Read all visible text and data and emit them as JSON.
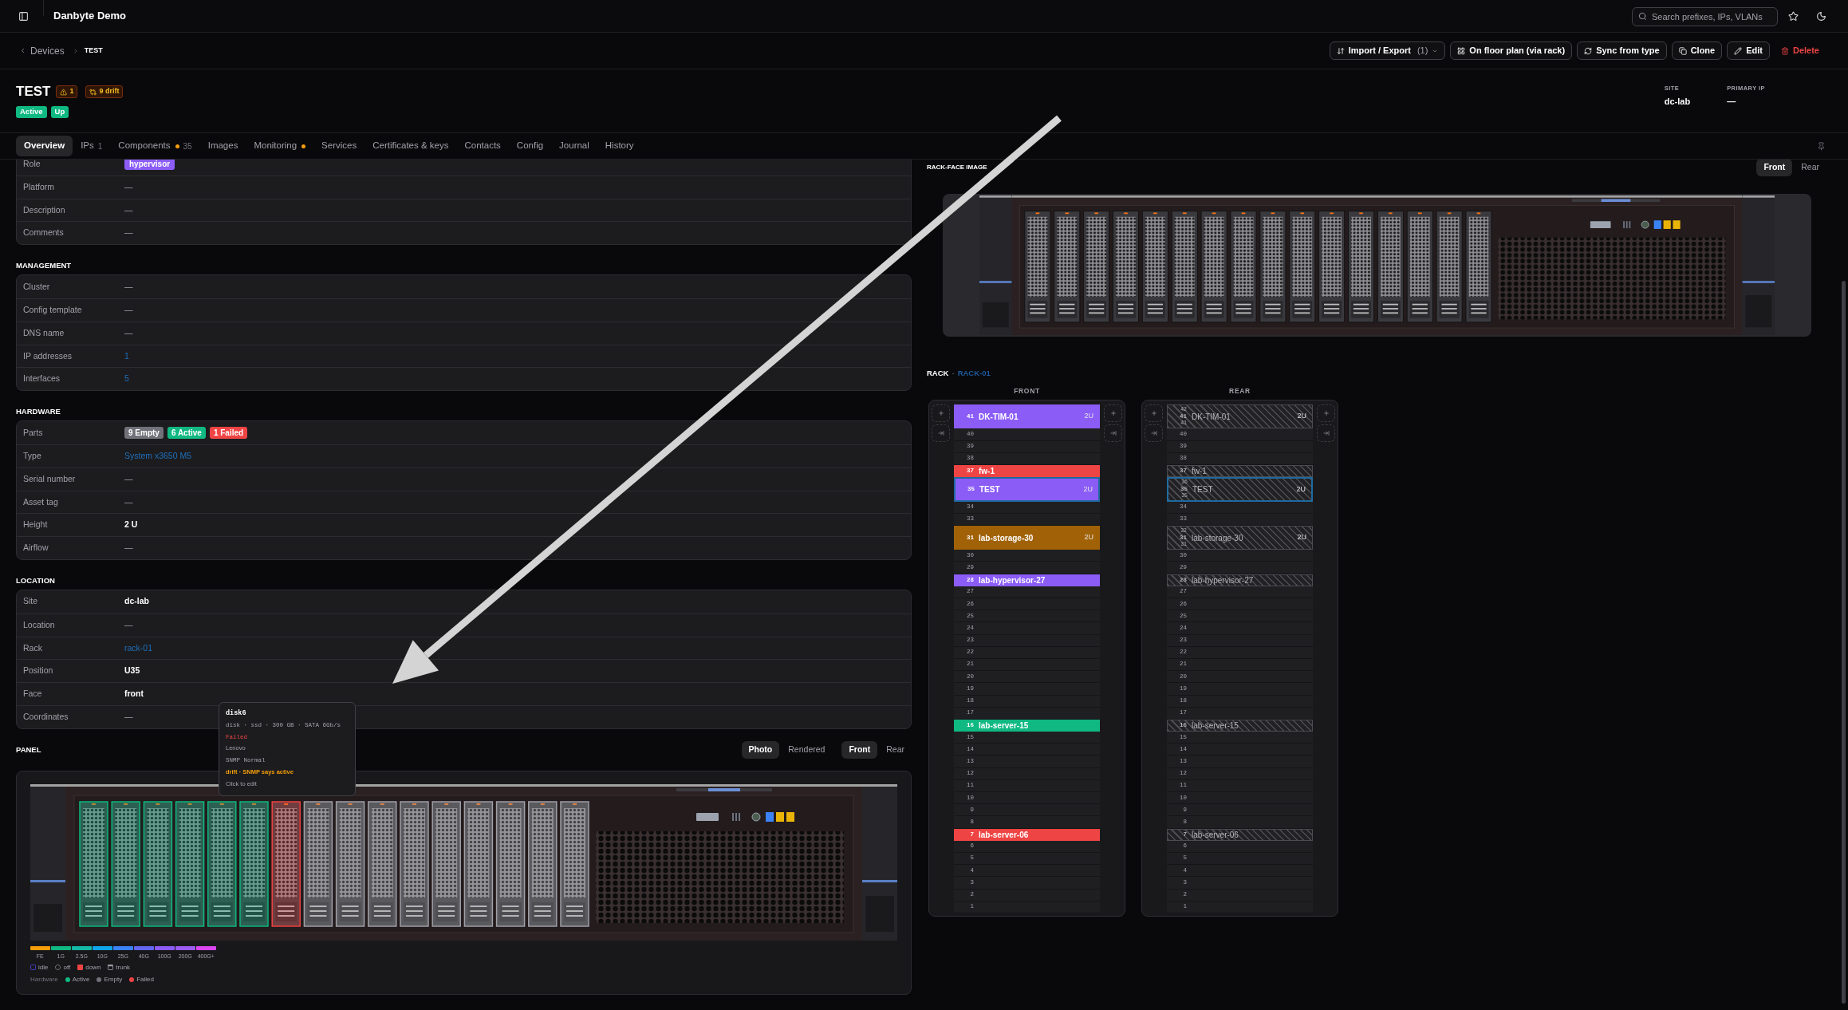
{
  "topbar": {
    "title": "Danbyte Demo",
    "search": {
      "placeholder": "Search prefixes, IPs, VLANs"
    }
  },
  "breadcrumb": {
    "parent": "Devices",
    "current": "TEST"
  },
  "actions": [
    {
      "label": "Import / Export",
      "count": "(1)",
      "kind": "menu"
    },
    {
      "label": "On floor plan (via rack)",
      "kind": "button"
    },
    {
      "label": "Sync from type",
      "kind": "button"
    },
    {
      "label": "Clone",
      "kind": "button"
    },
    {
      "label": "Edit",
      "kind": "button"
    },
    {
      "label": "Delete",
      "kind": "danger"
    }
  ],
  "device": {
    "name": "TEST",
    "warnings": "1",
    "drift": "9 drift",
    "statuses": [
      "Active",
      "Up"
    ],
    "facts": [
      {
        "label": "SITE",
        "value": "dc-lab"
      },
      {
        "label": "PRIMARY IP",
        "value": "—"
      }
    ]
  },
  "tabs": [
    {
      "label": "Overview",
      "selected": true,
      "dot": false
    },
    {
      "label": "IPs",
      "count": "1",
      "selected": false,
      "dot": false
    },
    {
      "label": "Components",
      "count": "35",
      "selected": false,
      "dot": true
    },
    {
      "label": "Images",
      "selected": false,
      "dot": false
    },
    {
      "label": "Monitoring",
      "selected": false,
      "dot": true
    },
    {
      "label": "Services",
      "selected": false,
      "dot": false
    },
    {
      "label": "Certificates & keys",
      "selected": false,
      "dot": false
    },
    {
      "label": "Contacts",
      "selected": false,
      "dot": false
    },
    {
      "label": "Config",
      "selected": false,
      "dot": false
    },
    {
      "label": "Journal",
      "selected": false,
      "dot": false
    },
    {
      "label": "History",
      "selected": false,
      "dot": false
    }
  ],
  "sections": [
    {
      "rows": [
        {
          "label": "Role",
          "kind": "badge",
          "value": "hypervisor"
        },
        {
          "label": "Platform",
          "kind": "muted",
          "value": "—"
        },
        {
          "label": "Description",
          "kind": "muted",
          "value": "—"
        },
        {
          "label": "Comments",
          "kind": "muted",
          "value": "—"
        }
      ]
    },
    {
      "title": "MANAGEMENT",
      "rows": [
        {
          "label": "Cluster",
          "kind": "muted",
          "value": "—"
        },
        {
          "label": "Config template",
          "kind": "muted",
          "value": "—"
        },
        {
          "label": "DNS name",
          "kind": "muted",
          "value": "—"
        },
        {
          "label": "IP addresses",
          "kind": "link",
          "value": "1"
        },
        {
          "label": "Interfaces",
          "kind": "link",
          "value": "5"
        }
      ]
    },
    {
      "title": "HARDWARE",
      "rows": [
        {
          "label": "Parts",
          "kind": "tags",
          "tags": [
            {
              "label": "9 Empty",
              "color": "#71717a"
            },
            {
              "label": "6 Active",
              "color": "#10b981"
            },
            {
              "label": "1 Failed",
              "color": "#ef4444"
            }
          ]
        },
        {
          "label": "Type",
          "kind": "link",
          "value": "System x3650 M5"
        },
        {
          "label": "Serial number",
          "kind": "muted",
          "value": "—"
        },
        {
          "label": "Asset tag",
          "kind": "muted",
          "value": "—"
        },
        {
          "label": "Height",
          "kind": "strong",
          "value": "2 U"
        },
        {
          "label": "Airflow",
          "kind": "muted",
          "value": "—"
        }
      ]
    },
    {
      "title": "LOCATION",
      "rows": [
        {
          "label": "Site",
          "kind": "strong",
          "value": "dc-lab"
        },
        {
          "label": "Location",
          "kind": "muted",
          "value": "—"
        },
        {
          "label": "Rack",
          "kind": "link",
          "value": "rack-01"
        },
        {
          "label": "Position",
          "kind": "strong",
          "value": "U35"
        },
        {
          "label": "Face",
          "kind": "strong",
          "value": "front"
        },
        {
          "label": "Coordinates",
          "kind": "muted",
          "value": "—"
        }
      ]
    }
  ],
  "panel": {
    "title": "PANEL",
    "source_toggle": [
      {
        "label": "Photo",
        "selected": true
      },
      {
        "label": "Rendered",
        "selected": false
      }
    ],
    "face_toggle": [
      {
        "label": "Front",
        "selected": true
      },
      {
        "label": "Rear",
        "selected": false
      }
    ],
    "bays": [
      {
        "kind": "active"
      },
      {
        "kind": "active"
      },
      {
        "kind": "active"
      },
      {
        "kind": "active"
      },
      {
        "kind": "active"
      },
      {
        "kind": "active"
      },
      {
        "kind": "failed"
      },
      {
        "kind": "empty"
      },
      {
        "kind": "empty"
      },
      {
        "kind": "empty"
      },
      {
        "kind": "empty"
      },
      {
        "kind": "empty"
      },
      {
        "kind": "empty"
      },
      {
        "kind": "empty"
      },
      {
        "kind": "empty"
      },
      {
        "kind": "empty"
      }
    ],
    "tooltip": {
      "title": "disk6",
      "lines": [
        {
          "kind": "mono",
          "text": "disk · ssd · 300 GB · SATA 6Gb/s"
        },
        {
          "kind": "error",
          "text": "Failed"
        },
        {
          "kind": "plain",
          "text": "Lenovo"
        },
        {
          "kind": "mono",
          "text": "SNMP Normal"
        },
        {
          "kind": "warning",
          "text": "drift · SNMP says active"
        },
        {
          "kind": "hint",
          "text": "Click to edit"
        }
      ]
    },
    "speeds": [
      {
        "label": "FE",
        "color": "#f59e0b"
      },
      {
        "label": "1G",
        "color": "#10b981"
      },
      {
        "label": "2.5G",
        "color": "#14b8a6"
      },
      {
        "label": "10G",
        "color": "#0ea5e9"
      },
      {
        "label": "25G",
        "color": "#3b82f6"
      },
      {
        "label": "40G",
        "color": "#6366f1"
      },
      {
        "label": "100G",
        "color": "#8b5cf6"
      },
      {
        "label": "200G",
        "color": "#9b5cf2"
      },
      {
        "label": "400G+",
        "color": "#d946ef"
      }
    ],
    "link_states": [
      "idle",
      "off",
      "down",
      "trunk"
    ],
    "hardware_legend": {
      "label": "Hardware",
      "items": [
        {
          "label": "Active",
          "color": "#10b981"
        },
        {
          "label": "Empty",
          "color": "#71717a"
        },
        {
          "label": "Failed",
          "color": "#ef4444"
        }
      ]
    }
  },
  "rack_face": {
    "title": "RACK-FACE IMAGE",
    "toggle": [
      {
        "label": "Front",
        "selected": true
      },
      {
        "label": "Rear",
        "selected": false
      }
    ]
  },
  "rack": {
    "title": "RACK",
    "separator": "·",
    "name": "RACK-01",
    "faces": [
      {
        "title": "FRONT",
        "kind": "front",
        "units": [
          {
            "kind": "tall",
            "u": "41",
            "name": "DK-TIM-01",
            "size": "2U",
            "color": "#8b5cf6",
            "selected": false
          },
          {
            "kind": "empty",
            "u": "40"
          },
          {
            "kind": "empty",
            "u": "39"
          },
          {
            "kind": "empty",
            "u": "38"
          },
          {
            "kind": "device",
            "u": "37",
            "name": "fw-1",
            "color": "#ef4444",
            "selected": false
          },
          {
            "kind": "tall",
            "u": "35",
            "name": "TEST",
            "size": "2U",
            "color": "#8b5cf6",
            "selected": true
          },
          {
            "kind": "empty",
            "u": "34"
          },
          {
            "kind": "empty",
            "u": "33"
          },
          {
            "kind": "tall",
            "u": "31",
            "name": "lab-storage-30",
            "size": "2U",
            "color": "#a16207",
            "selected": false
          },
          {
            "kind": "empty",
            "u": "30"
          },
          {
            "kind": "empty",
            "u": "29"
          },
          {
            "kind": "device",
            "u": "28",
            "name": "lab-hypervisor-27",
            "color": "#8b5cf6",
            "selected": false
          },
          {
            "kind": "empty",
            "u": "27"
          },
          {
            "kind": "empty",
            "u": "26"
          },
          {
            "kind": "empty",
            "u": "25"
          },
          {
            "kind": "empty",
            "u": "24"
          },
          {
            "kind": "empty",
            "u": "23"
          },
          {
            "kind": "empty",
            "u": "22"
          },
          {
            "kind": "empty",
            "u": "21"
          },
          {
            "kind": "empty",
            "u": "20"
          },
          {
            "kind": "empty",
            "u": "19"
          },
          {
            "kind": "empty",
            "u": "18"
          },
          {
            "kind": "empty",
            "u": "17"
          },
          {
            "kind": "device",
            "u": "16",
            "name": "lab-server-15",
            "color": "#10b981",
            "selected": false
          },
          {
            "kind": "empty",
            "u": "15"
          },
          {
            "kind": "empty",
            "u": "14"
          },
          {
            "kind": "empty",
            "u": "13"
          },
          {
            "kind": "empty",
            "u": "12"
          },
          {
            "kind": "empty",
            "u": "11"
          },
          {
            "kind": "empty",
            "u": "10"
          },
          {
            "kind": "empty",
            "u": "9"
          },
          {
            "kind": "empty",
            "u": "8"
          },
          {
            "kind": "device",
            "u": "7",
            "name": "lab-server-06",
            "color": "#ef4444",
            "selected": false
          },
          {
            "kind": "empty",
            "u": "6"
          },
          {
            "kind": "empty",
            "u": "5"
          },
          {
            "kind": "empty",
            "u": "4"
          },
          {
            "kind": "empty",
            "u": "3"
          },
          {
            "kind": "empty",
            "u": "2"
          },
          {
            "kind": "empty",
            "u": "1"
          }
        ]
      },
      {
        "title": "REAR",
        "kind": "rear",
        "units": [
          {
            "kind": "tall",
            "upper": "42",
            "u": "41",
            "lower": "41",
            "name": "DK-TIM-01",
            "size": "2U",
            "selected": false
          },
          {
            "kind": "empty",
            "u": "40"
          },
          {
            "kind": "empty",
            "u": "39"
          },
          {
            "kind": "empty",
            "u": "38"
          },
          {
            "kind": "device",
            "u": "37",
            "name": "fw-1",
            "selected": false
          },
          {
            "kind": "tall",
            "upper": "36",
            "u": "35",
            "lower": "35",
            "name": "TEST",
            "size": "2U",
            "selected": true
          },
          {
            "kind": "empty",
            "u": "34"
          },
          {
            "kind": "empty",
            "u": "33"
          },
          {
            "kind": "tall",
            "upper": "32",
            "u": "31",
            "lower": "31",
            "name": "lab-storage-30",
            "size": "2U",
            "selected": false
          },
          {
            "kind": "empty",
            "u": "30"
          },
          {
            "kind": "empty",
            "u": "29"
          },
          {
            "kind": "device",
            "u": "28",
            "name": "lab-hypervisor-27",
            "selected": false
          },
          {
            "kind": "empty",
            "u": "27"
          },
          {
            "kind": "empty",
            "u": "26"
          },
          {
            "kind": "empty",
            "u": "25"
          },
          {
            "kind": "empty",
            "u": "24"
          },
          {
            "kind": "empty",
            "u": "23"
          },
          {
            "kind": "empty",
            "u": "22"
          },
          {
            "kind": "empty",
            "u": "21"
          },
          {
            "kind": "empty",
            "u": "20"
          },
          {
            "kind": "empty",
            "u": "19"
          },
          {
            "kind": "empty",
            "u": "18"
          },
          {
            "kind": "empty",
            "u": "17"
          },
          {
            "kind": "device",
            "u": "16",
            "name": "lab-server-15",
            "selected": false
          },
          {
            "kind": "empty",
            "u": "15"
          },
          {
            "kind": "empty",
            "u": "14"
          },
          {
            "kind": "empty",
            "u": "13"
          },
          {
            "kind": "empty",
            "u": "12"
          },
          {
            "kind": "empty",
            "u": "11"
          },
          {
            "kind": "empty",
            "u": "10"
          },
          {
            "kind": "empty",
            "u": "9"
          },
          {
            "kind": "empty",
            "u": "8"
          },
          {
            "kind": "device",
            "u": "7",
            "name": "lab-server-06",
            "selected": false
          },
          {
            "kind": "empty",
            "u": "6"
          },
          {
            "kind": "empty",
            "u": "5"
          },
          {
            "kind": "empty",
            "u": "4"
          },
          {
            "kind": "empty",
            "u": "3"
          },
          {
            "kind": "empty",
            "u": "2"
          },
          {
            "kind": "empty",
            "u": "1"
          }
        ]
      }
    ]
  }
}
